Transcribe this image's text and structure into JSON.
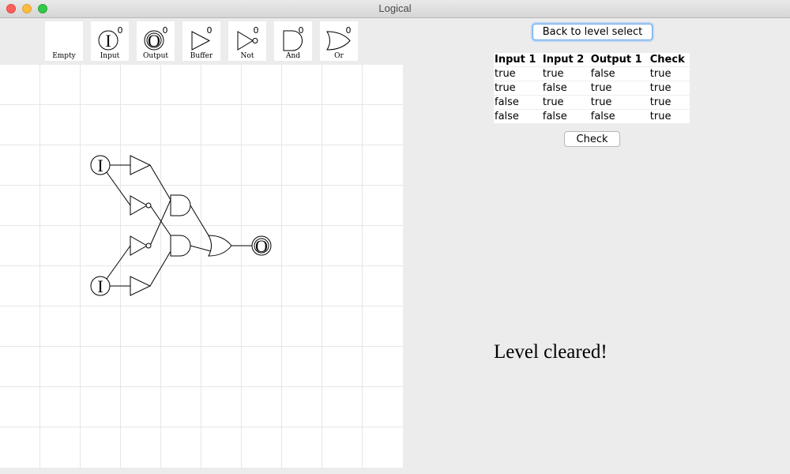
{
  "window": {
    "title": "Logical"
  },
  "palette": {
    "items": [
      {
        "label": "Empty",
        "icon": "empty-icon",
        "count": ""
      },
      {
        "label": "Input",
        "icon": "input-icon",
        "count": "0"
      },
      {
        "label": "Output",
        "icon": "output-icon",
        "count": "0"
      },
      {
        "label": "Buffer",
        "icon": "buffer-gate-icon",
        "count": "0"
      },
      {
        "label": "Not",
        "icon": "not-gate-icon",
        "count": "0"
      },
      {
        "label": "And",
        "icon": "and-gate-icon",
        "count": "0"
      },
      {
        "label": "Or",
        "icon": "or-gate-icon",
        "count": "0"
      }
    ]
  },
  "circuit": {
    "input_symbol": "I",
    "output_symbol": "O"
  },
  "controls": {
    "back_label": "Back to level select",
    "check_label": "Check"
  },
  "truth_table": {
    "headers": [
      "Input 1",
      "Input 2",
      "Output 1",
      "Check"
    ],
    "rows": [
      [
        "true",
        "true",
        "false",
        "true"
      ],
      [
        "true",
        "false",
        "true",
        "true"
      ],
      [
        "false",
        "true",
        "true",
        "true"
      ],
      [
        "false",
        "false",
        "false",
        "true"
      ]
    ]
  },
  "status": {
    "message": "Level cleared!"
  },
  "colors": {
    "grid": "#e6e6e6",
    "wire": "#000000",
    "focus_ring": "#6aa6ea"
  }
}
